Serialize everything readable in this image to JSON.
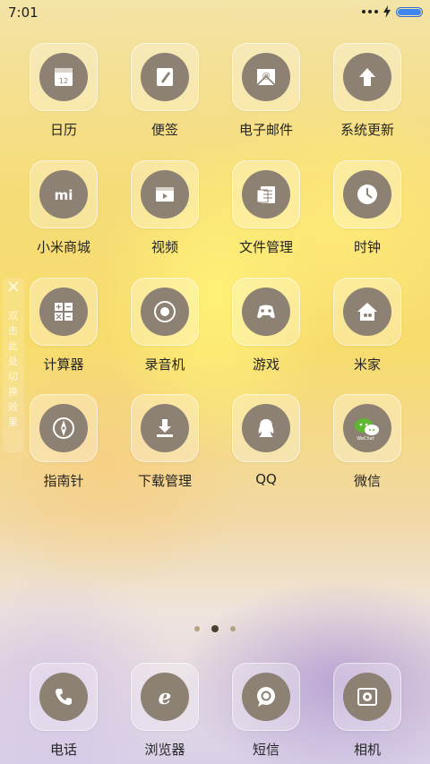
{
  "status_bar": {
    "time": "7:01",
    "battery_level": 1.0,
    "battery_color": "#3d86f0"
  },
  "apps": [
    {
      "label": "日历",
      "icon": "calendar-icon",
      "icon_text": "12"
    },
    {
      "label": "便签",
      "icon": "notes-icon"
    },
    {
      "label": "电子邮件",
      "icon": "email-icon"
    },
    {
      "label": "系统更新",
      "icon": "system-update-icon"
    },
    {
      "label": "小米商城",
      "icon": "mi-store-icon",
      "icon_text": "mi"
    },
    {
      "label": "视频",
      "icon": "video-icon"
    },
    {
      "label": "文件管理",
      "icon": "file-manager-icon"
    },
    {
      "label": "时钟",
      "icon": "clock-icon"
    },
    {
      "label": "计算器",
      "icon": "calculator-icon"
    },
    {
      "label": "录音机",
      "icon": "recorder-icon"
    },
    {
      "label": "游戏",
      "icon": "game-icon"
    },
    {
      "label": "米家",
      "icon": "mi-home-icon"
    },
    {
      "label": "指南针",
      "icon": "compass-icon"
    },
    {
      "label": "下载管理",
      "icon": "download-icon"
    },
    {
      "label": "QQ",
      "icon": "qq-icon"
    },
    {
      "label": "微信",
      "icon": "wechat-icon",
      "icon_text": "WeChat",
      "accent": "#5fb832"
    }
  ],
  "pager": {
    "pages": 3,
    "current": 2
  },
  "side_tab": {
    "text": "双击此处切换效果"
  },
  "dock": [
    {
      "label": "电话",
      "icon": "phone-icon"
    },
    {
      "label": "浏览器",
      "icon": "browser-icon",
      "icon_text": "e"
    },
    {
      "label": "短信",
      "icon": "sms-icon"
    },
    {
      "label": "相机",
      "icon": "camera-icon"
    }
  ]
}
